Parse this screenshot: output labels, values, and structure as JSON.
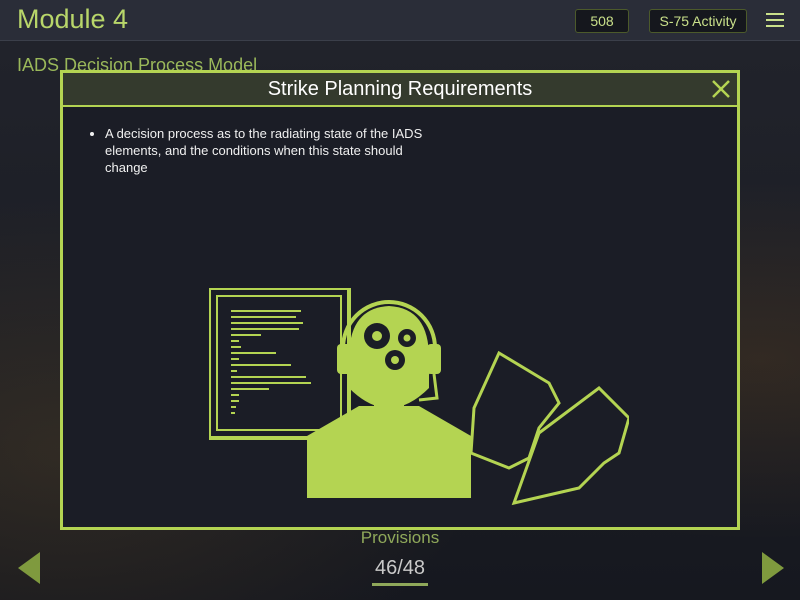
{
  "header": {
    "module_title": "Module 4",
    "score": "508",
    "activity_label": "S-75 Activity",
    "menu_icon": "hamburger-menu-icon"
  },
  "page": {
    "subtitle": "IADS Decision Process Model"
  },
  "modal": {
    "title": "Strike Planning Requirements",
    "close_icon": "close-x-icon",
    "bullets": [
      "A decision process as to the radiating state of the IADS elements, and the conditions when this state should change"
    ]
  },
  "footer": {
    "section_label": "Provisions",
    "page_indicator": "46/48",
    "prev_icon": "triangle-left-icon",
    "next_icon": "triangle-right-icon"
  },
  "colors": {
    "accent": "#b4d452",
    "background": "#1b1d26"
  }
}
